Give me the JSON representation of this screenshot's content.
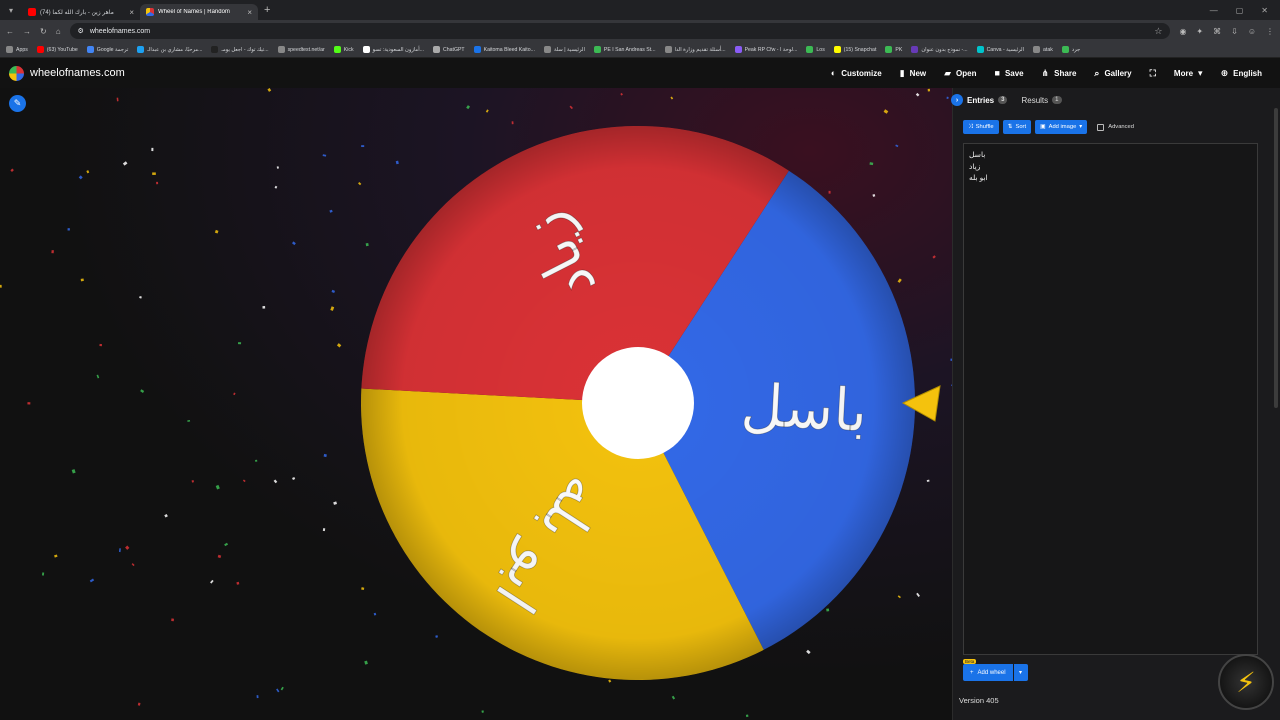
{
  "browser": {
    "tabs": [
      {
        "title": "(74) ماهر زين - بارك الله لكما",
        "color": "#ff0000",
        "active": false
      },
      {
        "title": "Wheel of Names | Random",
        "color": "#4285f4",
        "active": true
      }
    ],
    "url": "wheelofnames.com",
    "bookmarks": [
      {
        "label": "Apps",
        "color": "#888888"
      },
      {
        "label": "(63) YouTube",
        "color": "#ff0000"
      },
      {
        "label": "Google ترجمة",
        "color": "#4285f4"
      },
      {
        "label": "مرحبًا، مشاري بن عبدالـ...",
        "color": "#1da1f2"
      },
      {
        "label": "تيك توك - اجعل يومـ...",
        "color": "#222222"
      },
      {
        "label": "speedtest.net/ar",
        "color": "#888888"
      },
      {
        "label": "Kick",
        "color": "#53fc18"
      },
      {
        "label": "أمازون السعودية: تسو...",
        "color": "#ffffff"
      },
      {
        "label": "ChatGPT",
        "color": "#aaaaaa"
      },
      {
        "label": "Kaitoma Bleed Kaito...",
        "color": "#1a73e8"
      },
      {
        "label": "الرئيسية | سلة",
        "color": "#888888"
      },
      {
        "label": "PE I San Andreas St...",
        "color": "#3cba54"
      },
      {
        "label": "أسئلة تقديم وزارة الدا...",
        "color": "#888888"
      },
      {
        "label": "Peak RP Cfw - لوحة ا...",
        "color": "#8a5cf5"
      },
      {
        "label": "Los",
        "color": "#3cba54"
      },
      {
        "label": "(15) Snapchat",
        "color": "#fffc00"
      },
      {
        "label": "PK",
        "color": "#3cba54"
      },
      {
        "label": "نموذج بدون عنوان -...",
        "color": "#673ab7"
      },
      {
        "label": "Canva - الرئيسية",
        "color": "#00c4cc"
      },
      {
        "label": "atak",
        "color": "#888888"
      },
      {
        "label": "جرد",
        "color": "#3cba54"
      }
    ]
  },
  "app": {
    "site_name": "wheelofnames.com",
    "nav": [
      {
        "label": "Customize",
        "icon": "palette-icon",
        "glyph": "◐"
      },
      {
        "label": "New",
        "icon": "file-icon",
        "glyph": "▮"
      },
      {
        "label": "Open",
        "icon": "folder-icon",
        "glyph": "▰"
      },
      {
        "label": "Save",
        "icon": "save-icon",
        "glyph": "■"
      },
      {
        "label": "Share",
        "icon": "share-icon",
        "glyph": "⋔"
      },
      {
        "label": "Gallery",
        "icon": "search-icon",
        "glyph": "⌕"
      },
      {
        "label": "",
        "icon": "fullscreen-icon",
        "glyph": "⛶"
      },
      {
        "label": "More",
        "icon": "chevron-down-icon",
        "glyph": "▾"
      },
      {
        "label": "English",
        "icon": "globe-icon",
        "glyph": "⊕"
      }
    ]
  },
  "wheel": {
    "segments": [
      {
        "label": "باسل",
        "color": "#3369e8"
      },
      {
        "label": "ابو بله",
        "color": "#f4c20d"
      },
      {
        "label": "زياد",
        "color": "#db3236"
      }
    ],
    "pointer_color": "#f4c20d"
  },
  "panel": {
    "tabs": [
      {
        "label": "Entries",
        "count": "3",
        "active": true
      },
      {
        "label": "Results",
        "count": "1",
        "active": false
      }
    ],
    "toolbar": {
      "shuffle": "Shuffle",
      "sort": "Sort",
      "add_image": "Add image",
      "advanced": "Advanced"
    },
    "entries": [
      "باسل",
      "زياد",
      "ابو بله"
    ],
    "add_wheel": "Add wheel",
    "beta": "Beta",
    "version": "Version 405"
  }
}
